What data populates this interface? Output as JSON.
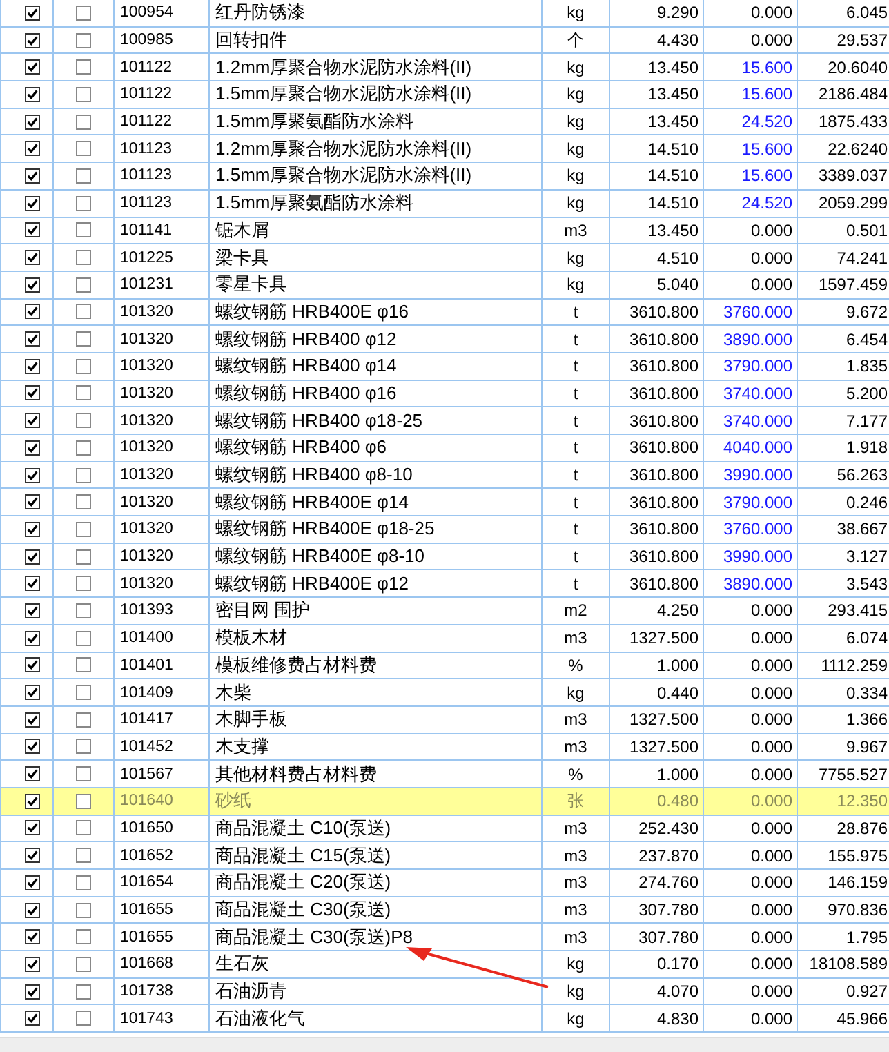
{
  "table": {
    "rows": [
      {
        "checked": true,
        "flag": false,
        "selected": false,
        "code": "100954",
        "name": "红丹防锈漆",
        "unit": "kg",
        "price": "9.290",
        "market_price": "0.000",
        "adjusted": false,
        "amount": "6.045"
      },
      {
        "checked": true,
        "flag": false,
        "selected": false,
        "code": "100985",
        "name": "回转扣件",
        "unit": "个",
        "price": "4.430",
        "market_price": "0.000",
        "adjusted": false,
        "amount": "29.537"
      },
      {
        "checked": true,
        "flag": false,
        "selected": false,
        "code": "101122",
        "name": "1.2mm厚聚合物水泥防水涂料(II)",
        "unit": "kg",
        "price": "13.450",
        "market_price": "15.600",
        "adjusted": true,
        "amount": "20.6040"
      },
      {
        "checked": true,
        "flag": false,
        "selected": false,
        "code": "101122",
        "name": "1.5mm厚聚合物水泥防水涂料(II)",
        "unit": "kg",
        "price": "13.450",
        "market_price": "15.600",
        "adjusted": true,
        "amount": "2186.484"
      },
      {
        "checked": true,
        "flag": false,
        "selected": false,
        "code": "101122",
        "name": "1.5mm厚聚氨酯防水涂料",
        "unit": "kg",
        "price": "13.450",
        "market_price": "24.520",
        "adjusted": true,
        "amount": "1875.433"
      },
      {
        "checked": true,
        "flag": false,
        "selected": false,
        "code": "101123",
        "name": "1.2mm厚聚合物水泥防水涂料(II)",
        "unit": "kg",
        "price": "14.510",
        "market_price": "15.600",
        "adjusted": true,
        "amount": "22.6240"
      },
      {
        "checked": true,
        "flag": false,
        "selected": false,
        "code": "101123",
        "name": "1.5mm厚聚合物水泥防水涂料(II)",
        "unit": "kg",
        "price": "14.510",
        "market_price": "15.600",
        "adjusted": true,
        "amount": "3389.037"
      },
      {
        "checked": true,
        "flag": false,
        "selected": false,
        "code": "101123",
        "name": "1.5mm厚聚氨酯防水涂料",
        "unit": "kg",
        "price": "14.510",
        "market_price": "24.520",
        "adjusted": true,
        "amount": "2059.299"
      },
      {
        "checked": true,
        "flag": false,
        "selected": false,
        "code": "101141",
        "name": "锯木屑",
        "unit": "m3",
        "price": "13.450",
        "market_price": "0.000",
        "adjusted": false,
        "amount": "0.501"
      },
      {
        "checked": true,
        "flag": false,
        "selected": false,
        "code": "101225",
        "name": "梁卡具",
        "unit": "kg",
        "price": "4.510",
        "market_price": "0.000",
        "adjusted": false,
        "amount": "74.241"
      },
      {
        "checked": true,
        "flag": false,
        "selected": false,
        "code": "101231",
        "name": "零星卡具",
        "unit": "kg",
        "price": "5.040",
        "market_price": "0.000",
        "adjusted": false,
        "amount": "1597.459"
      },
      {
        "checked": true,
        "flag": false,
        "selected": false,
        "code": "101320",
        "name": "螺纹钢筋 HRB400E φ16",
        "unit": "t",
        "price": "3610.800",
        "market_price": "3760.000",
        "adjusted": true,
        "amount": "9.672"
      },
      {
        "checked": true,
        "flag": false,
        "selected": false,
        "code": "101320",
        "name": "螺纹钢筋 HRB400 φ12",
        "unit": "t",
        "price": "3610.800",
        "market_price": "3890.000",
        "adjusted": true,
        "amount": "6.454"
      },
      {
        "checked": true,
        "flag": false,
        "selected": false,
        "code": "101320",
        "name": "螺纹钢筋 HRB400 φ14",
        "unit": "t",
        "price": "3610.800",
        "market_price": "3790.000",
        "adjusted": true,
        "amount": "1.835"
      },
      {
        "checked": true,
        "flag": false,
        "selected": false,
        "code": "101320",
        "name": "螺纹钢筋 HRB400 φ16",
        "unit": "t",
        "price": "3610.800",
        "market_price": "3740.000",
        "adjusted": true,
        "amount": "5.200"
      },
      {
        "checked": true,
        "flag": false,
        "selected": false,
        "code": "101320",
        "name": "螺纹钢筋 HRB400 φ18-25",
        "unit": "t",
        "price": "3610.800",
        "market_price": "3740.000",
        "adjusted": true,
        "amount": "7.177"
      },
      {
        "checked": true,
        "flag": false,
        "selected": false,
        "code": "101320",
        "name": "螺纹钢筋 HRB400 φ6",
        "unit": "t",
        "price": "3610.800",
        "market_price": "4040.000",
        "adjusted": true,
        "amount": "1.918"
      },
      {
        "checked": true,
        "flag": false,
        "selected": false,
        "code": "101320",
        "name": "螺纹钢筋 HRB400 φ8-10",
        "unit": "t",
        "price": "3610.800",
        "market_price": "3990.000",
        "adjusted": true,
        "amount": "56.263"
      },
      {
        "checked": true,
        "flag": false,
        "selected": false,
        "code": "101320",
        "name": "螺纹钢筋 HRB400E φ14",
        "unit": "t",
        "price": "3610.800",
        "market_price": "3790.000",
        "adjusted": true,
        "amount": "0.246"
      },
      {
        "checked": true,
        "flag": false,
        "selected": false,
        "code": "101320",
        "name": "螺纹钢筋 HRB400E φ18-25",
        "unit": "t",
        "price": "3610.800",
        "market_price": "3760.000",
        "adjusted": true,
        "amount": "38.667"
      },
      {
        "checked": true,
        "flag": false,
        "selected": false,
        "code": "101320",
        "name": "螺纹钢筋 HRB400E φ8-10",
        "unit": "t",
        "price": "3610.800",
        "market_price": "3990.000",
        "adjusted": true,
        "amount": "3.127"
      },
      {
        "checked": true,
        "flag": false,
        "selected": false,
        "code": "101320",
        "name": "螺纹钢筋 HRB400E φ12",
        "unit": "t",
        "price": "3610.800",
        "market_price": "3890.000",
        "adjusted": true,
        "amount": "3.543"
      },
      {
        "checked": true,
        "flag": false,
        "selected": false,
        "code": "101393",
        "name": "密目网 围护",
        "unit": "m2",
        "price": "4.250",
        "market_price": "0.000",
        "adjusted": false,
        "amount": "293.415"
      },
      {
        "checked": true,
        "flag": false,
        "selected": false,
        "code": "101400",
        "name": "模板木材",
        "unit": "m3",
        "price": "1327.500",
        "market_price": "0.000",
        "adjusted": false,
        "amount": "6.074"
      },
      {
        "checked": true,
        "flag": false,
        "selected": false,
        "code": "101401",
        "name": "模板维修费占材料费",
        "unit": "%",
        "price": "1.000",
        "market_price": "0.000",
        "adjusted": false,
        "amount": "1112.259"
      },
      {
        "checked": true,
        "flag": false,
        "selected": false,
        "code": "101409",
        "name": "木柴",
        "unit": "kg",
        "price": "0.440",
        "market_price": "0.000",
        "adjusted": false,
        "amount": "0.334"
      },
      {
        "checked": true,
        "flag": false,
        "selected": false,
        "code": "101417",
        "name": "木脚手板",
        "unit": "m3",
        "price": "1327.500",
        "market_price": "0.000",
        "adjusted": false,
        "amount": "1.366"
      },
      {
        "checked": true,
        "flag": false,
        "selected": false,
        "code": "101452",
        "name": "木支撑",
        "unit": "m3",
        "price": "1327.500",
        "market_price": "0.000",
        "adjusted": false,
        "amount": "9.967"
      },
      {
        "checked": true,
        "flag": false,
        "selected": false,
        "code": "101567",
        "name": "其他材料费占材料费",
        "unit": "%",
        "price": "1.000",
        "market_price": "0.000",
        "adjusted": false,
        "amount": "7755.527"
      },
      {
        "checked": true,
        "flag": false,
        "selected": true,
        "code": "101640",
        "name": "砂纸",
        "unit": "张",
        "price": "0.480",
        "market_price": "0.000",
        "adjusted": false,
        "amount": "12.350"
      },
      {
        "checked": true,
        "flag": false,
        "selected": false,
        "code": "101650",
        "name": "商品混凝土 C10(泵送)",
        "unit": "m3",
        "price": "252.430",
        "market_price": "0.000",
        "adjusted": false,
        "amount": "28.876"
      },
      {
        "checked": true,
        "flag": false,
        "selected": false,
        "code": "101652",
        "name": "商品混凝土 C15(泵送)",
        "unit": "m3",
        "price": "237.870",
        "market_price": "0.000",
        "adjusted": false,
        "amount": "155.975"
      },
      {
        "checked": true,
        "flag": false,
        "selected": false,
        "code": "101654",
        "name": "商品混凝土 C20(泵送)",
        "unit": "m3",
        "price": "274.760",
        "market_price": "0.000",
        "adjusted": false,
        "amount": "146.159"
      },
      {
        "checked": true,
        "flag": false,
        "selected": false,
        "code": "101655",
        "name": "商品混凝土 C30(泵送)",
        "unit": "m3",
        "price": "307.780",
        "market_price": "0.000",
        "adjusted": false,
        "amount": "970.836"
      },
      {
        "checked": true,
        "flag": false,
        "selected": false,
        "code": "101655",
        "name": "商品混凝土 C30(泵送)P8",
        "unit": "m3",
        "price": "307.780",
        "market_price": "0.000",
        "adjusted": false,
        "amount": "1.795"
      },
      {
        "checked": true,
        "flag": false,
        "selected": false,
        "code": "101668",
        "name": "生石灰",
        "unit": "kg",
        "price": "0.170",
        "market_price": "0.000",
        "adjusted": false,
        "amount": "18108.589"
      },
      {
        "checked": true,
        "flag": false,
        "selected": false,
        "code": "101738",
        "name": "石油沥青",
        "unit": "kg",
        "price": "4.070",
        "market_price": "0.000",
        "adjusted": false,
        "amount": "0.927"
      },
      {
        "checked": true,
        "flag": false,
        "selected": false,
        "code": "101743",
        "name": "石油液化气",
        "unit": "kg",
        "price": "4.830",
        "market_price": "0.000",
        "adjusted": false,
        "amount": "45.966"
      }
    ]
  }
}
